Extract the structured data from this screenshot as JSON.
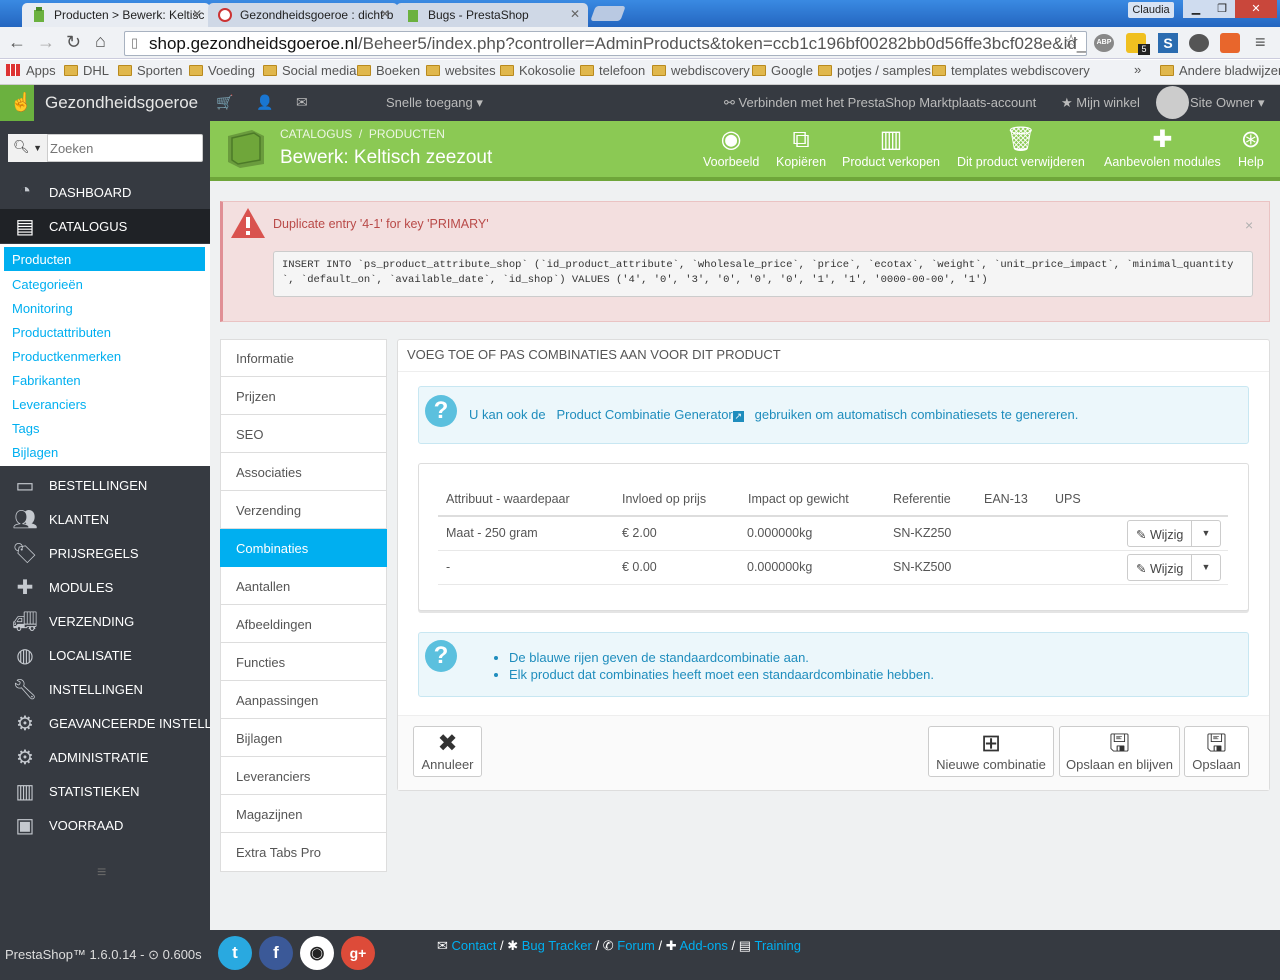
{
  "browser": {
    "tabs": [
      {
        "title": "Producten > Bewerk: Keltisc",
        "active": true
      },
      {
        "title": "Gezondheidsgoeroe : dicht b",
        "active": false
      },
      {
        "title": "Bugs - PrestaShop",
        "active": false
      }
    ],
    "user": "Claudia",
    "url_host": "shop.gezondheidsgoeroe.nl",
    "url_rest": "/Beheer5/index.php?controller=AdminProducts&token=ccb1c196bf00282bb0d56ffe3bcf028e&id_prod",
    "bookmarks": [
      "Apps",
      "DHL",
      "Sporten",
      "Voeding",
      "Social media",
      "Boeken",
      "websites",
      "Kokosolie",
      "telefoon",
      "webdiscovery",
      "Google",
      "potjes / samples",
      "templates webdiscovery"
    ],
    "more_bookmarks": "»",
    "other_bookmarks": "Andere bladwijzers",
    "extension_badge": "5"
  },
  "header": {
    "brand": "Gezondheidsgoeroe",
    "quick_access": "Snelle toegang",
    "marketplace": "Verbinden met het PrestaShop Marktplaats-account",
    "my_shop": "Mijn winkel",
    "owner": "Site Owner"
  },
  "sidebar": {
    "search_placeholder": "Zoeken",
    "menu": [
      {
        "label": "DASHBOARD",
        "icon": "dashboard-icon"
      },
      {
        "label": "CATALOGUS",
        "icon": "book-icon"
      },
      {
        "label": "BESTELLINGEN",
        "icon": "credit-card-icon"
      },
      {
        "label": "KLANTEN",
        "icon": "users-icon"
      },
      {
        "label": "PRIJSREGELS",
        "icon": "tags-icon"
      },
      {
        "label": "MODULES",
        "icon": "puzzle-icon"
      },
      {
        "label": "VERZENDING",
        "icon": "truck-icon"
      },
      {
        "label": "LOCALISATIE",
        "icon": "globe-icon"
      },
      {
        "label": "INSTELLINGEN",
        "icon": "wrench-icon"
      },
      {
        "label": "GEAVANCEERDE INSTELLI...",
        "icon": "cogs-icon"
      },
      {
        "label": "ADMINISTRATIE",
        "icon": "gear-icon"
      },
      {
        "label": "STATISTIEKEN",
        "icon": "bar-chart-icon"
      },
      {
        "label": "VOORRAAD",
        "icon": "archive-icon"
      }
    ],
    "submenu": [
      "Producten",
      "Categorieën",
      "Monitoring",
      "Productattributen",
      "Productkenmerken",
      "Fabrikanten",
      "Leveranciers",
      "Tags",
      "Bijlagen"
    ]
  },
  "page": {
    "breadcrumb_1": "CATALOGUS",
    "breadcrumb_sep": "/",
    "breadcrumb_2": "PRODUCTEN",
    "title": "Bewerk: Keltisch zeezout",
    "toolbar": [
      "Voorbeeld",
      "Kopiëren",
      "Product verkopen",
      "Dit product verwijderen",
      "Aanbevolen modules",
      "Help"
    ]
  },
  "alert": {
    "message": "Duplicate entry '4-1' for key 'PRIMARY'",
    "sql": "INSERT INTO `ps_product_attribute_shop` (`id_product_attribute`, `wholesale_price`, `price`, `ecotax`, `weight`, `unit_price_impact`, `minimal_quantity`, `default_on`, `available_date`, `id_shop`) VALUES ('4', '0', '3', '0', '0', '0', '1', '1', '0000-00-00', '1')",
    "close": "×"
  },
  "product_tabs": [
    "Informatie",
    "Prijzen",
    "SEO",
    "Associaties",
    "Verzending",
    "Combinaties",
    "Aantallen",
    "Afbeeldingen",
    "Functies",
    "Aanpassingen",
    "Bijlagen",
    "Leveranciers",
    "Magazijnen",
    "Extra Tabs Pro"
  ],
  "panel": {
    "title": "VOEG TOE OF PAS COMBINATIES AAN VOOR DIT PRODUCT",
    "info_prefix": "U kan ook de",
    "info_link": "Product Combinatie Generator",
    "info_suffix": "gebruiken om automatisch combinatiesets te genereren.",
    "columns": [
      "Attribuut - waardepaar",
      "Invloed op prijs",
      "Impact op gewicht",
      "Referentie",
      "EAN-13",
      "UPS"
    ],
    "rows": [
      {
        "attribute": "Maat - 250 gram",
        "price": "€ 2.00",
        "weight": "0.000000kg",
        "reference": "SN-KZ250",
        "ean": "",
        "ups": "",
        "edit": "Wijzig"
      },
      {
        "attribute": "-",
        "price": "€ 0.00",
        "weight": "0.000000kg",
        "reference": "SN-KZ500",
        "ean": "",
        "ups": "",
        "edit": "Wijzig"
      }
    ],
    "notes": [
      "De blauwe rijen geven de standaardcombinatie aan.",
      "Elk product dat combinaties heeft moet een standaardcombinatie hebben."
    ],
    "buttons": {
      "cancel": "Annuleer",
      "new": "Nieuwe combinatie",
      "save_stay": "Opslaan en blijven",
      "save": "Opslaan"
    }
  },
  "footer": {
    "version": "PrestaShop™ 1.6.0.14 - ",
    "time": "0.600s",
    "links": [
      "Contact",
      "Bug Tracker",
      "Forum",
      "Add-ons",
      "Training"
    ],
    "sep": "/"
  },
  "colors": {
    "accent": "#00aff0",
    "header_green": "#8bc954",
    "sidebar": "#363a41",
    "alert_bg": "#f3dfdf",
    "alert_text": "#b94a48"
  }
}
